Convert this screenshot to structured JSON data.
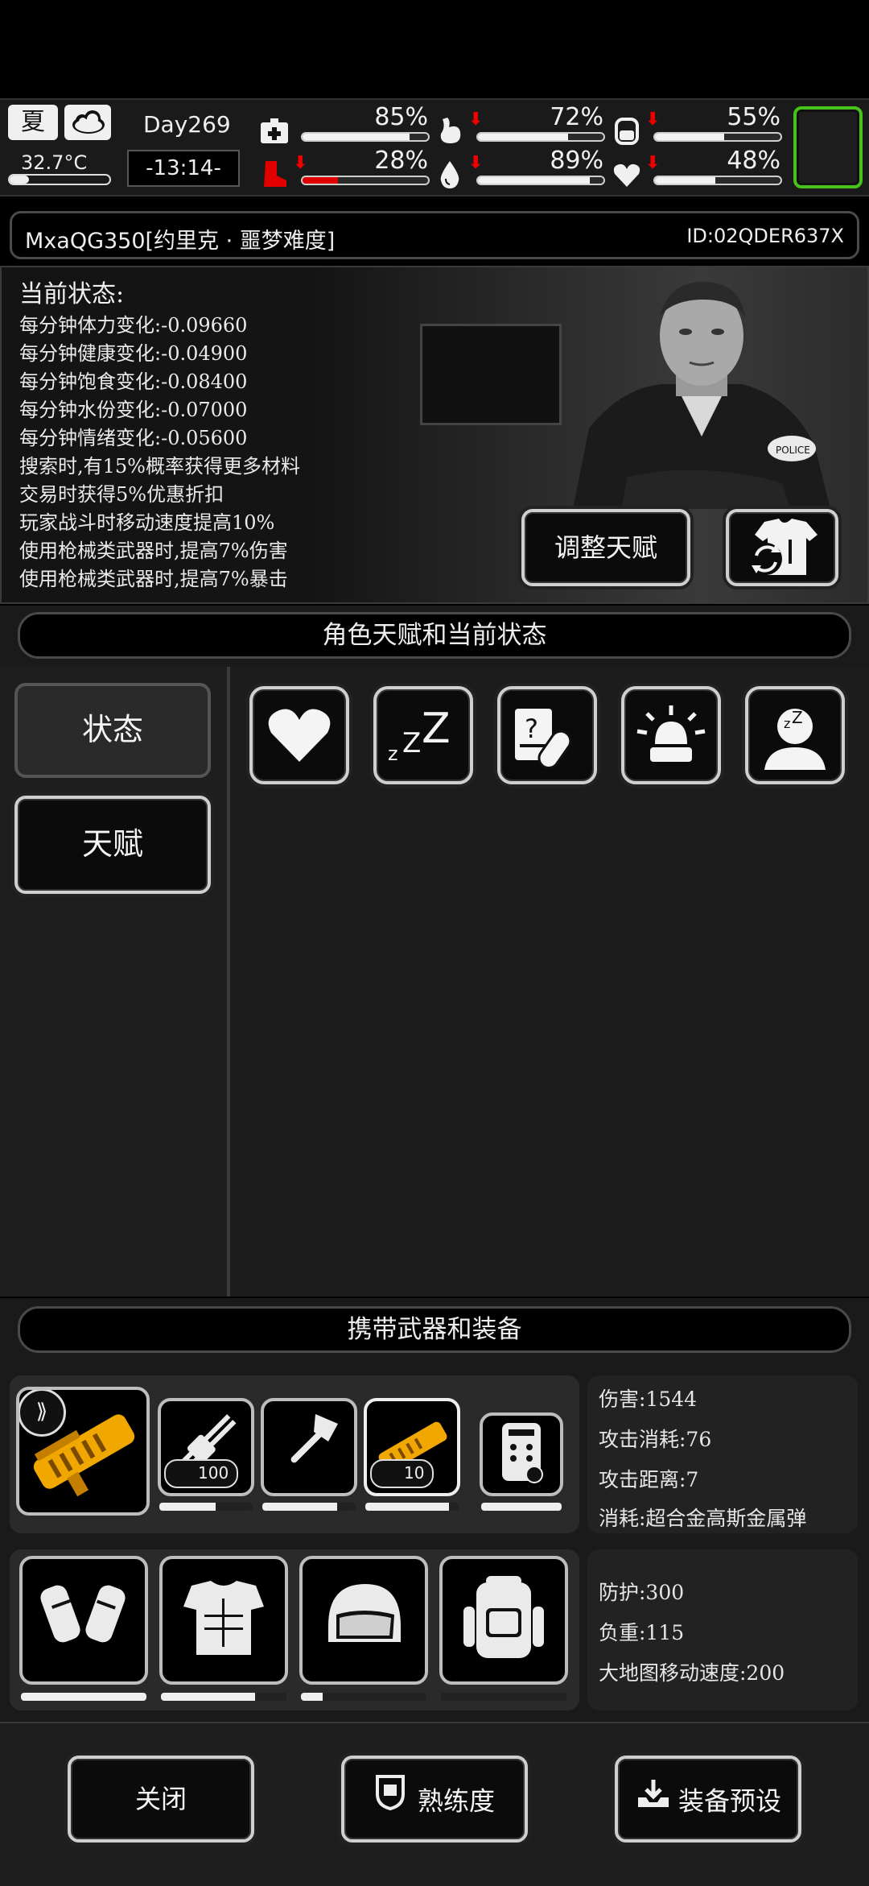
{
  "top": {
    "season": "夏",
    "temperature": "32.7°C",
    "day": "Day269",
    "time": "-13:14-",
    "stats": [
      {
        "name": "medical-icon",
        "pct": "85%",
        "value": 85,
        "down": false
      },
      {
        "name": "stomach-icon",
        "pct": "72%",
        "value": 72,
        "down": true
      },
      {
        "name": "energy-icon",
        "pct": "55%",
        "value": 55,
        "down": true
      },
      {
        "name": "boot-icon",
        "pct": "28%",
        "value": 28,
        "down": true,
        "critical": true
      },
      {
        "name": "water-drop-icon",
        "pct": "89%",
        "value": 89,
        "down": true
      },
      {
        "name": "heart-icon",
        "pct": "48%",
        "value": 48,
        "down": true
      }
    ]
  },
  "player": {
    "name": "MxaQG350[约里克 · 噩梦难度]",
    "id": "ID:02QDER637X"
  },
  "status": {
    "title": "当前状态:",
    "lines": [
      "每分钟体力变化:-0.09660",
      "每分钟健康变化:-0.04900",
      "每分钟饱食变化:-0.08400",
      "每分钟水份变化:-0.07000",
      "每分钟情绪变化:-0.05600",
      "搜索时,有15%概率获得更多材料",
      "交易时获得5%优惠折扣",
      "玩家战斗时移动速度提高10%",
      "使用枪械类武器时,提高7%伤害",
      "使用枪械类武器时,提高7%暴击"
    ],
    "adjust_button": "调整天赋"
  },
  "section1": {
    "title": "角色天赋和当前状态"
  },
  "tabs": {
    "status": "状态",
    "talent": "天赋"
  },
  "status_icons": [
    "heart-icon",
    "sleep-icon",
    "medicine-icon",
    "alarm-icon",
    "sleepy-person-icon"
  ],
  "section2": {
    "title": "携带武器和装备"
  },
  "weapons": [
    {
      "name": "rocket-launcher",
      "durability": 0.0
    },
    {
      "name": "minigun",
      "count": "100",
      "durability": 0.6
    },
    {
      "name": "axe",
      "durability": 0.8
    },
    {
      "name": "rocket-launcher-secondary",
      "count": "10",
      "durability": 0.9
    },
    {
      "name": "device",
      "durability": 1.0
    }
  ],
  "weapon_info": {
    "damage": "伤害:1544",
    "attack_cost": "攻击消耗:76",
    "attack_range": "攻击距离:7",
    "consume": "消耗:超合金高斯金属弹"
  },
  "armor": [
    {
      "name": "gauntlets",
      "durability": 1.0
    },
    {
      "name": "body-armor",
      "durability": 0.75
    },
    {
      "name": "helmet",
      "durability": 0.17
    },
    {
      "name": "backpack",
      "durability": 0.0
    }
  ],
  "armor_info": {
    "defense": "防护:300",
    "load": "负重:115",
    "map_speed": "大地图移动速度:200"
  },
  "bottom": {
    "close": "关闭",
    "proficiency": "熟练度",
    "preset": "装备预设"
  },
  "colors": {
    "accent_green": "#46c21b",
    "alert_red": "#e00000",
    "weapon_gold": "#f0a800"
  }
}
